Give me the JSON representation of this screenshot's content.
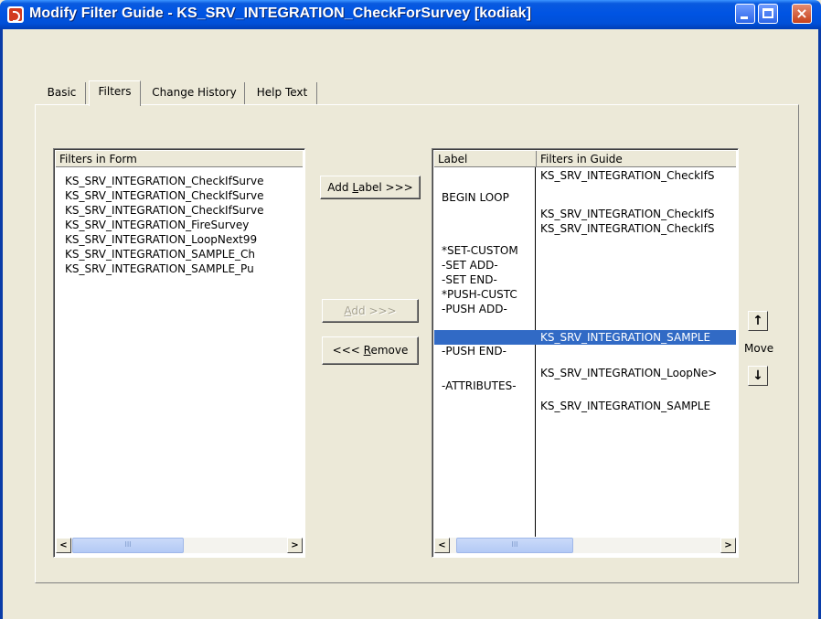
{
  "window": {
    "title": "Modify Filter Guide - KS_SRV_INTEGRATION_CheckForSurvey [kodiak]",
    "controls": {
      "minimize": "min-icon",
      "maximize": "max-icon",
      "close": "×"
    }
  },
  "tabs": [
    {
      "label": "Basic",
      "selected": false
    },
    {
      "label": "Filters",
      "selected": true
    },
    {
      "label": "Change History",
      "selected": false
    },
    {
      "label": "Help Text",
      "selected": false
    }
  ],
  "filters_in_form": {
    "header": "Filters in Form",
    "items": [
      "KS_SRV_INTEGRATION_CheckIfSurve",
      "KS_SRV_INTEGRATION_CheckIfSurve",
      "KS_SRV_INTEGRATION_CheckIfSurve",
      "KS_SRV_INTEGRATION_FireSurvey",
      "KS_SRV_INTEGRATION_LoopNext99",
      "KS_SRV_INTEGRATION_SAMPLE_Ch",
      "KS_SRV_INTEGRATION_SAMPLE_Pu"
    ]
  },
  "buttons": {
    "add_label_prefix": "Add ",
    "add_label_key": "L",
    "add_label_suffix": "abel >>>",
    "add_key": "A",
    "add_suffix": "dd >>>",
    "remove_prefix": "<<< ",
    "remove_key": "R",
    "remove_suffix": "emove"
  },
  "guide": {
    "label_header": "Label",
    "filters_header": "Filters in Guide",
    "labels": [
      "",
      "BEGIN LOOP",
      "",
      "",
      "*SET-CUSTOM",
      "-SET ADD-",
      "-SET END-",
      "*PUSH-CUSTC",
      "-PUSH ADD-",
      "",
      "-PUSH END-",
      "",
      "-ATTRIBUTES-"
    ],
    "filters": [
      "KS_SRV_INTEGRATION_CheckIfS",
      "",
      "KS_SRV_INTEGRATION_CheckIfS",
      "KS_SRV_INTEGRATION_CheckIfS",
      "",
      "",
      "",
      "",
      "",
      "KS_SRV_INTEGRATION_SAMPLE",
      "",
      "KS_SRV_INTEGRATION_LoopNe>",
      "",
      "KS_SRV_INTEGRATION_SAMPLE"
    ],
    "selected_row": 9
  },
  "move": {
    "label": "Move",
    "up_icon": "↑",
    "down_icon": "↓"
  },
  "scrollbar": {
    "left": "<",
    "right": ">",
    "grip": "III"
  }
}
